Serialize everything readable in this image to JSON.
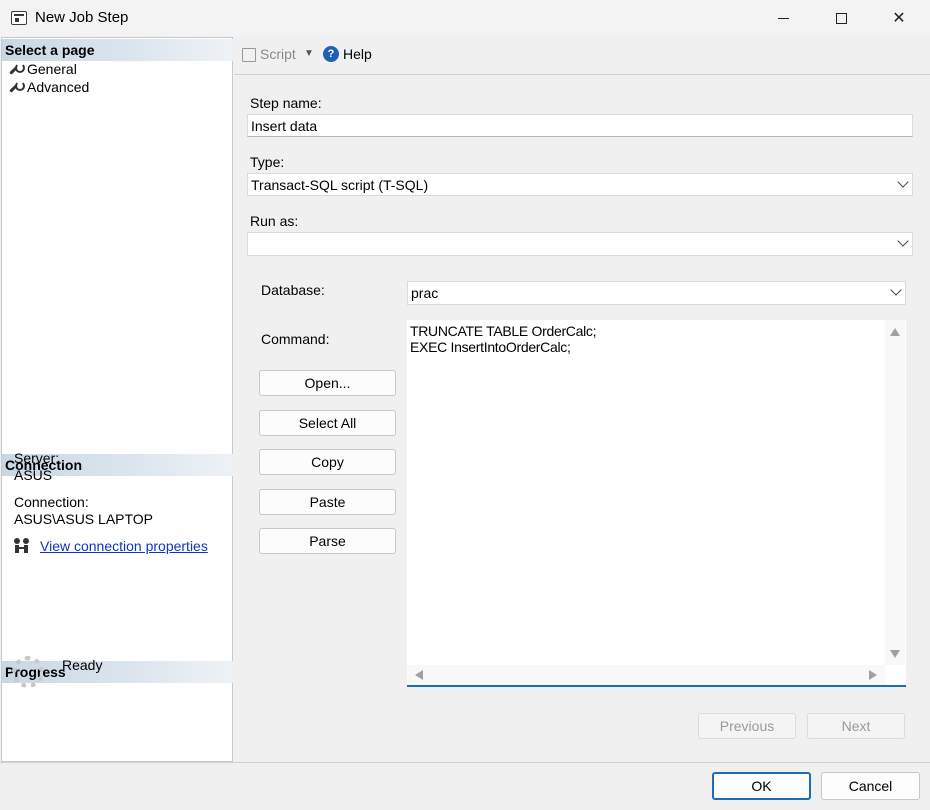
{
  "window": {
    "title": "New Job Step",
    "minimize_glyph": "",
    "close_glyph": "✕"
  },
  "left": {
    "select_page_header": "Select a page",
    "pages": [
      {
        "label": "General",
        "icon": "wrench-icon"
      },
      {
        "label": "Advanced",
        "icon": "wrench-icon"
      }
    ],
    "connection_header": "Connection",
    "server_label": "Server:",
    "server_value": "ASUS",
    "connection_label": "Connection:",
    "connection_value": "ASUS\\ASUS LAPTOP",
    "view_connection_link": "View connection properties",
    "progress_header": "Progress",
    "progress_status": "Ready"
  },
  "toolbar": {
    "script_label": "Script",
    "help_label": "Help"
  },
  "form": {
    "step_name_label": "Step name:",
    "step_name_value": "Insert data",
    "type_label": "Type:",
    "type_value": "Transact-SQL script (T-SQL)",
    "run_as_label": "Run as:",
    "run_as_value": "",
    "database_label": "Database:",
    "database_value": "prac",
    "command_label": "Command:",
    "command_text": "TRUNCATE TABLE OrderCalc;\nEXEC InsertIntoOrderCalc;"
  },
  "buttons": {
    "open": "Open...",
    "select_all": "Select All",
    "copy": "Copy",
    "paste": "Paste",
    "parse": "Parse",
    "previous": "Previous",
    "next": "Next",
    "ok": "OK",
    "cancel": "Cancel"
  },
  "colors": {
    "accent": "#1e6bb8",
    "link": "#0a35c8",
    "header_gradient_start": "#c9d7e4"
  }
}
